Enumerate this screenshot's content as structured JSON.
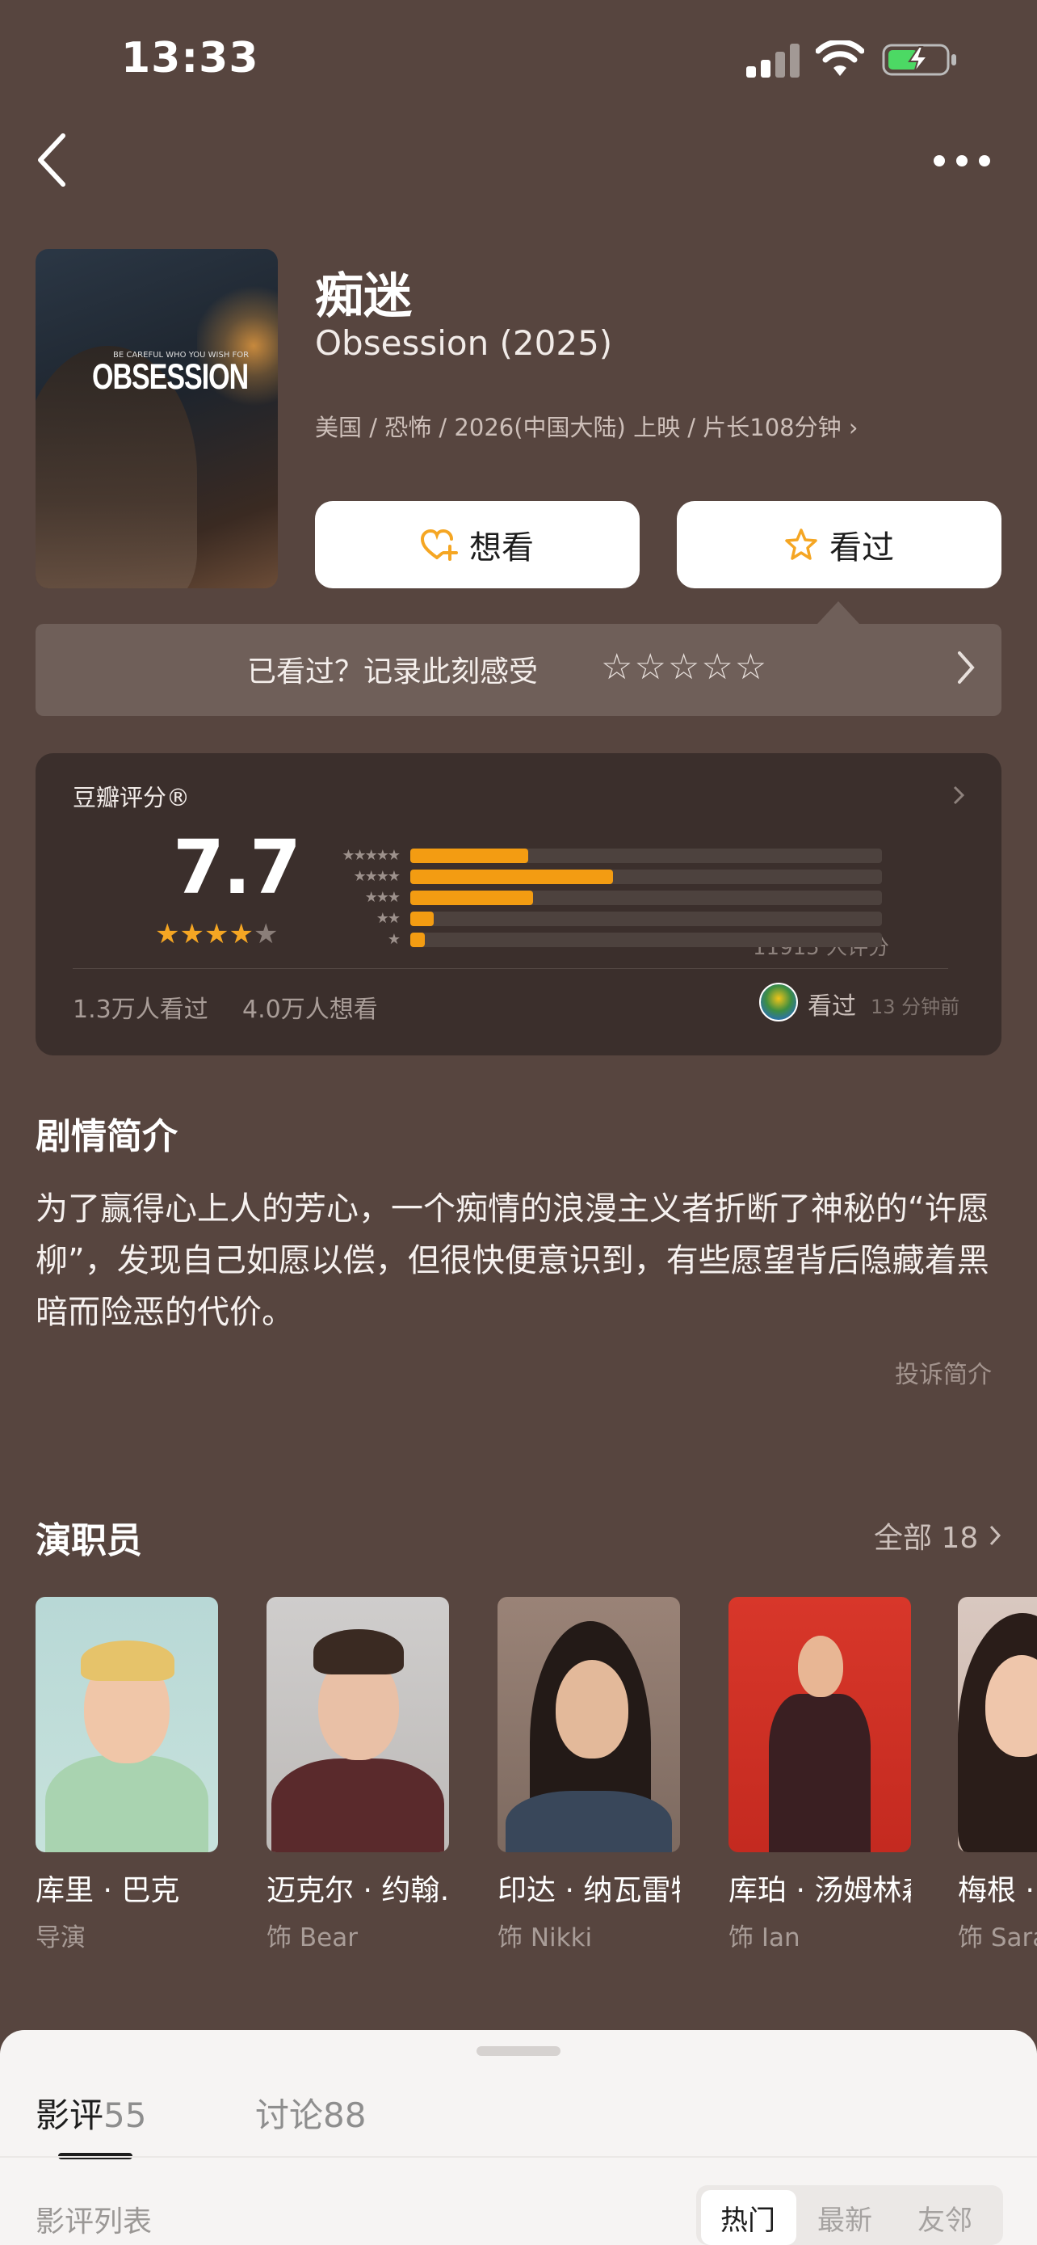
{
  "status_bar": {
    "time": "13:33"
  },
  "movie": {
    "poster_title": "OBSESSION",
    "poster_tag": "BE CAREFUL WHO YOU WISH FOR",
    "title_cn": "痴迷",
    "title_en": "Obsession (2025)",
    "meta": "美国 / 恐怖 / 2026(中国大陆) 上映 / 片长108分钟 ›"
  },
  "actions": {
    "want_label": "想看",
    "seen_label": "看过"
  },
  "record": {
    "prompt": "已看过？记录此刻感受",
    "stars": "☆☆☆☆☆"
  },
  "rating": {
    "label": "豆瓣评分®",
    "score": "7.7",
    "stars_filled": 4,
    "distribution": [
      {
        "stars": "★★★★★",
        "fraction": 0.25
      },
      {
        "stars": "★★★★",
        "fraction": 0.43
      },
      {
        "stars": "★★★",
        "fraction": 0.26
      },
      {
        "stars": "★★",
        "fraction": 0.05
      },
      {
        "stars": "★",
        "fraction": 0.03
      }
    ],
    "count_text": "11915 人评分",
    "watched_text": "1.3万人看过",
    "wish_text": "4.0万人想看",
    "friend_status": "看过",
    "friend_time": "13 分钟前"
  },
  "synopsis": {
    "title": "剧情简介",
    "text": "为了赢得心上人的芳心，一个痴情的浪漫主义者折断了神秘的“许愿柳”，发现自己如愿以偿，但很快便意识到，有些愿望背后隐藏着黑暗而险恶的代价。",
    "report_link": "投诉简介"
  },
  "cast": {
    "title": "演职员",
    "all_label": "全部 18",
    "members": [
      {
        "name": "库里 · 巴克",
        "role": "导演"
      },
      {
        "name": "迈克尔 · 约翰…",
        "role": "饰 Bear"
      },
      {
        "name": "印达 · 纳瓦雷特",
        "role": "饰 Nikki"
      },
      {
        "name": "库珀 · 汤姆林森",
        "role": "饰 Ian"
      },
      {
        "name": "梅根 · ",
        "role": "饰 Sara"
      }
    ]
  },
  "sheet": {
    "tabs": [
      {
        "label": "影评",
        "count": "55"
      },
      {
        "label": "讨论",
        "count": "88"
      }
    ],
    "list_label": "影评列表",
    "sort_options": [
      "热门",
      "最新",
      "友邻"
    ]
  },
  "colors": {
    "accent": "#f39c12",
    "background": "#57453f",
    "card": "#3b2f2c"
  }
}
